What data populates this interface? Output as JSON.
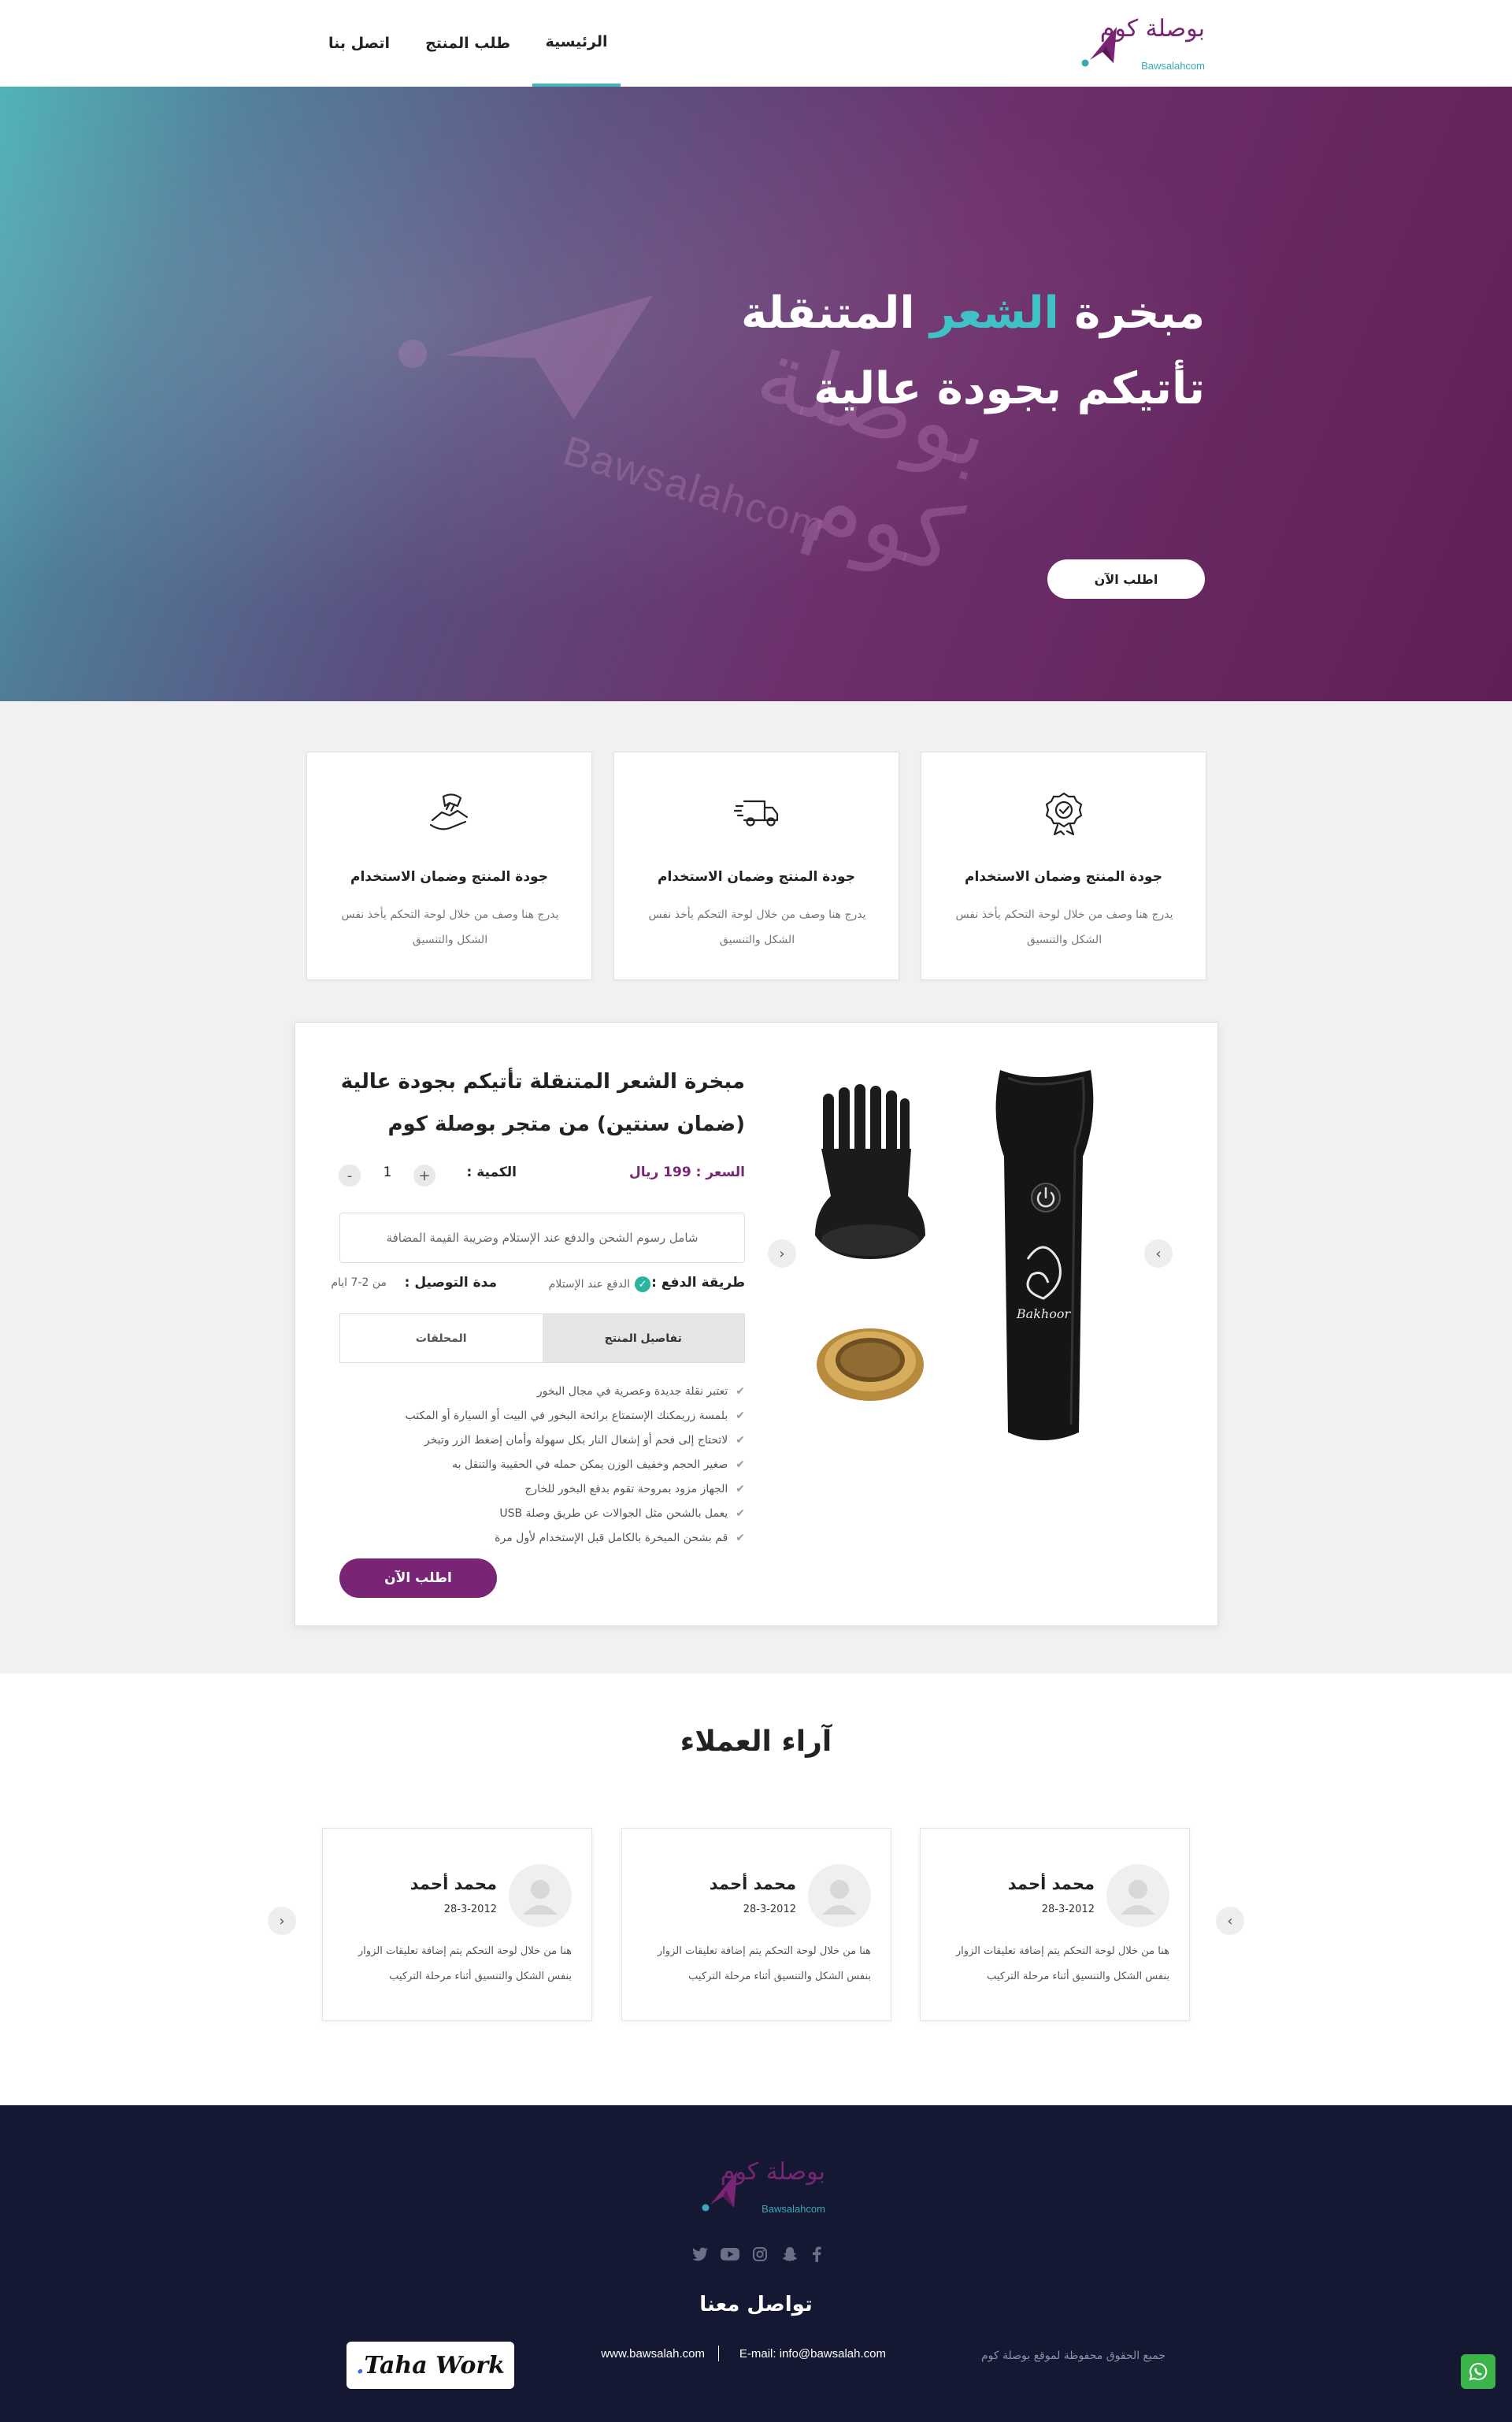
{
  "header": {
    "logo_ar": "بوصلة كوم",
    "logo_en": "Bawsalahcom",
    "nav": [
      {
        "label": "الرئيسية",
        "active": true
      },
      {
        "label": "طلب المنتج",
        "active": false
      },
      {
        "label": "اتصل بنا",
        "active": false
      }
    ]
  },
  "hero": {
    "title_part1": "مبخرة",
    "title_highlight": "الشعر",
    "title_part2": "المتنقلة",
    "title_line2": "تأتيكم بجودة عالية",
    "button": "اطلب الآن",
    "watermark_ar": "بوصلة كوم",
    "watermark_en": "Bawsalahcom",
    "colors": {
      "start": "#4fb3b7",
      "end": "#601f55",
      "highlight": "#3fc2c6"
    }
  },
  "features": [
    {
      "icon": "handshake-icon",
      "title": "جودة المنتج وضمان الاستخدام",
      "desc": "يدرج هنا وصف من خلال لوحة التحكم يأخذ نفس الشكل والتنسيق"
    },
    {
      "icon": "delivery-truck-icon",
      "title": "جودة المنتج وضمان الاستخدام",
      "desc": "يدرج هنا وصف من خلال لوحة التحكم يأخذ نفس الشكل والتنسيق"
    },
    {
      "icon": "award-badge-icon",
      "title": "جودة المنتج وضمان الاستخدام",
      "desc": "يدرج هنا وصف من خلال لوحة التحكم يأخذ نفس الشكل والتنسيق"
    }
  ],
  "product": {
    "title": "مبخرة الشعر المتنقلة تأتيكم بجودة عالية (ضمان سنتين) من متجر بوصلة كوم",
    "price": "السعر : 199 ريال",
    "qty_label": "الكمية :",
    "qty_value": "1",
    "qty_plus": "+",
    "qty_minus": "-",
    "shipping_note": "شامل رسوم الشحن والدفع عند الإستلام وضريبة القيمة المضافة",
    "payment_label": "طريقة الدفع :",
    "payment_value": "الدفع عند الإستلام",
    "delivery_label": "مدة التوصيل :",
    "delivery_value": "من 2-7 ايام",
    "tabs": [
      {
        "label": "تفاصيل المنتج",
        "active": true
      },
      {
        "label": "المحلقات",
        "active": false
      }
    ],
    "features": [
      "تعتبر نقلة جديدة وعصرية في مجال البخور",
      "بلمسة زريمكنك الإستمتاع برائحة البخور في البيت أو السيارة أو المكتب",
      "لاتحتاج إلى فحم أو إشعال النار بكل سهولة وأمان إضغط الزر وتبخر",
      "صغير الحجم وخفيف الوزن يمكن حمله في الحقيبة والتنقل به",
      "الجهاز مزود بمروحة تقوم بدفع البخور للخارج",
      "يعمل بالشحن مثل الجوالات عن طريق وصلة USB",
      "قم بشحن المبخرة بالكامل قبل الإستخدام لأول مرة"
    ],
    "buy_button": "اطلب الآن",
    "device_brand": "Bakhoor",
    "accent": "#7a2475"
  },
  "testimonials": {
    "title": "آراء العملاء",
    "items": [
      {
        "name": "محمد أحمد",
        "date": "28-3-2012",
        "text": "هنا من خلال لوحة التحكم يتم إضافة تعليقات الزوار بنفس الشكل والتنسيق أثناء مرحلة التركيب"
      },
      {
        "name": "محمد أحمد",
        "date": "28-3-2012",
        "text": "هنا من خلال لوحة التحكم يتم إضافة تعليقات الزوار بنفس الشكل والتنسيق أثناء مرحلة التركيب"
      },
      {
        "name": "محمد أحمد",
        "date": "28-3-2012",
        "text": "هنا من خلال لوحة التحكم يتم إضافة تعليقات الزوار بنفس الشكل والتنسيق أثناء مرحلة التركيب"
      }
    ]
  },
  "footer": {
    "logo_ar": "بوصلة كوم",
    "logo_en": "Bawsalahcom",
    "social": [
      "facebook-icon",
      "snapchat-icon",
      "instagram-icon",
      "youtube-icon",
      "twitter-icon"
    ],
    "contact_title": "تواصل معنا",
    "copyright": "جميع الحقوق محفوظة لموقع بوصلة كوم",
    "email": "E-mail: info@bawsalah.com",
    "website": "www.bawsalah.com",
    "credit_name": "Taha Work",
    "credit_dot": ".",
    "whatsapp_icon": "whatsapp-icon",
    "background": "#141833"
  }
}
